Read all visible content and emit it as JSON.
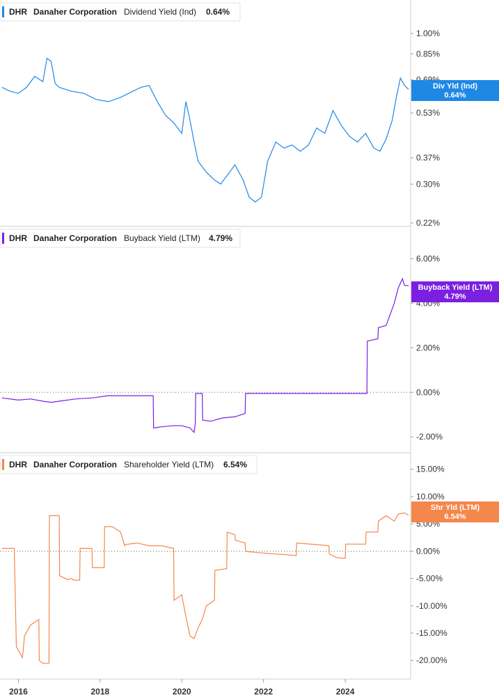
{
  "colors": {
    "dividend": "#1e88e5",
    "buyback": "#7b1fe0",
    "shareholder": "#f4874b",
    "grid_zero": "#666666",
    "axis": "#cccccc"
  },
  "chart_data": [
    {
      "type": "line",
      "panel": "dividend",
      "legend": {
        "ticker": "DHR",
        "company": "Danaher Corporation",
        "metric": "Dividend Yield (Ind)",
        "value": "0.64%"
      },
      "badge": {
        "label": "Div Yld (Ind)",
        "value": "0.64%"
      },
      "y_scale": "log",
      "ylim": [
        0.22,
        1.25
      ],
      "y_ticks": [
        1.0,
        0.85,
        0.69,
        0.53,
        0.37,
        0.3,
        0.22
      ],
      "y_tick_labels": [
        "1.00%",
        "0.85%",
        "0.69%",
        "0.53%",
        "0.37%",
        "0.30%",
        "0.22%"
      ],
      "zero_line": false,
      "series": [
        {
          "x": [
            2015.6,
            2015.8,
            2016.0,
            2016.2,
            2016.4,
            2016.6,
            2016.7,
            2016.8,
            2016.9,
            2017.0,
            2017.3,
            2017.6,
            2017.9,
            2018.2,
            2018.5,
            2018.8,
            2019.0,
            2019.2,
            2019.4,
            2019.6,
            2019.8,
            2020.0,
            2020.1,
            2020.2,
            2020.3,
            2020.4,
            2020.6,
            2020.8,
            2020.95,
            2021.1,
            2021.3,
            2021.5,
            2021.65,
            2021.8,
            2021.95,
            2022.1,
            2022.3,
            2022.5,
            2022.7,
            2022.9,
            2023.1,
            2023.3,
            2023.5,
            2023.7,
            2023.9,
            2024.1,
            2024.3,
            2024.5,
            2024.7,
            2024.85,
            2025.0,
            2025.15,
            2025.25,
            2025.35,
            2025.45,
            2025.55
          ],
          "y": [
            0.65,
            0.63,
            0.62,
            0.65,
            0.71,
            0.68,
            0.82,
            0.8,
            0.67,
            0.65,
            0.63,
            0.62,
            0.59,
            0.58,
            0.6,
            0.63,
            0.65,
            0.66,
            0.58,
            0.52,
            0.49,
            0.45,
            0.58,
            0.5,
            0.42,
            0.36,
            0.33,
            0.31,
            0.3,
            0.32,
            0.35,
            0.31,
            0.27,
            0.26,
            0.27,
            0.36,
            0.42,
            0.4,
            0.41,
            0.39,
            0.41,
            0.47,
            0.45,
            0.54,
            0.48,
            0.44,
            0.42,
            0.45,
            0.4,
            0.39,
            0.43,
            0.5,
            0.6,
            0.7,
            0.66,
            0.64
          ]
        }
      ]
    },
    {
      "type": "line",
      "panel": "buyback",
      "legend": {
        "ticker": "DHR",
        "company": "Danaher Corporation",
        "metric": "Buyback Yield (LTM)",
        "value": "4.79%"
      },
      "badge": {
        "label": "Buyback Yield (LTM)",
        "value": "4.79%"
      },
      "y_scale": "linear",
      "ylim": [
        -2.4,
        6.2
      ],
      "y_ticks": [
        6,
        4,
        2,
        0,
        -2
      ],
      "y_tick_labels": [
        "6.00%",
        "4.00%",
        "2.00%",
        "0.00%",
        "-2.00%"
      ],
      "zero_line": true,
      "series": [
        {
          "x": [
            2015.6,
            2016.0,
            2016.3,
            2016.6,
            2016.8,
            2017.0,
            2017.4,
            2017.8,
            2018.2,
            2018.6,
            2019.0,
            2019.3,
            2019.31,
            2019.5,
            2019.8,
            2020.0,
            2020.2,
            2020.3,
            2020.33,
            2020.34,
            2020.5,
            2020.51,
            2020.7,
            2021.0,
            2021.3,
            2021.55,
            2021.56,
            2022.0,
            2022.5,
            2023.0,
            2023.5,
            2024.0,
            2024.5,
            2024.53,
            2024.54,
            2024.8,
            2024.81,
            2025.0,
            2025.2,
            2025.3,
            2025.4,
            2025.45,
            2025.55
          ],
          "y": [
            -0.25,
            -0.35,
            -0.3,
            -0.4,
            -0.45,
            -0.4,
            -0.3,
            -0.25,
            -0.15,
            -0.15,
            -0.15,
            -0.15,
            -1.6,
            -1.55,
            -1.5,
            -1.5,
            -1.6,
            -1.8,
            -1.4,
            -0.05,
            -0.05,
            -1.25,
            -1.3,
            -1.15,
            -1.1,
            -0.95,
            -0.05,
            -0.05,
            -0.05,
            -0.05,
            -0.05,
            -0.05,
            -0.05,
            -0.05,
            2.3,
            2.4,
            2.9,
            3.0,
            4.0,
            4.7,
            5.1,
            4.8,
            4.79
          ]
        }
      ]
    },
    {
      "type": "line",
      "panel": "shareholder",
      "legend": {
        "ticker": "DHR",
        "company": "Danaher Corporation",
        "metric": "Shareholder Yield (LTM)",
        "value": "6.54%"
      },
      "badge": {
        "label": "Shr Yld (LTM)",
        "value": "6.54%"
      },
      "y_scale": "linear",
      "ylim": [
        -21.5,
        17
      ],
      "y_ticks": [
        15,
        10,
        5,
        0,
        -5,
        -10,
        -15,
        -20
      ],
      "y_tick_labels": [
        "15.00%",
        "10.00%",
        "5.00%",
        "0.00%",
        "-5.00%",
        "-10.00%",
        "-15.00%",
        "-20.00%"
      ],
      "zero_line": true,
      "series": [
        {
          "x": [
            2015.6,
            2015.9,
            2015.95,
            2016.1,
            2016.15,
            2016.3,
            2016.5,
            2016.51,
            2016.6,
            2016.75,
            2016.76,
            2017.0,
            2017.01,
            2017.2,
            2017.3,
            2017.35,
            2017.5,
            2017.51,
            2017.8,
            2017.81,
            2018.1,
            2018.11,
            2018.3,
            2018.5,
            2018.6,
            2018.61,
            2018.9,
            2019.2,
            2019.5,
            2019.8,
            2019.81,
            2020.0,
            2020.1,
            2020.2,
            2020.3,
            2020.4,
            2020.5,
            2020.6,
            2020.8,
            2020.81,
            2021.1,
            2021.11,
            2021.3,
            2021.31,
            2021.55,
            2021.56,
            2021.9,
            2022.3,
            2022.8,
            2022.81,
            2023.3,
            2023.6,
            2023.61,
            2023.8,
            2024.0,
            2024.01,
            2024.5,
            2024.51,
            2024.8,
            2024.81,
            2025.0,
            2025.2,
            2025.3,
            2025.45,
            2025.55
          ],
          "y": [
            0.5,
            0.5,
            -17.5,
            -19.5,
            -15.5,
            -13.5,
            -12.5,
            -20,
            -20.5,
            -20.5,
            6.5,
            6.5,
            -4.5,
            -5.2,
            -5.0,
            -5.3,
            -5.3,
            0.5,
            0.5,
            -3.0,
            -3.0,
            4.5,
            4.5,
            3.5,
            1.0,
            1.2,
            1.5,
            1.0,
            1.0,
            0.5,
            -9,
            -8,
            -12,
            -15.5,
            -16,
            -14,
            -12.5,
            -10,
            -9,
            -3.5,
            -3.2,
            3.5,
            3.0,
            2.0,
            1.5,
            0,
            -0.3,
            -0.5,
            -0.8,
            1.5,
            1.2,
            1.0,
            -0.5,
            -1.2,
            -1.3,
            1.3,
            1.3,
            3.5,
            3.5,
            5.5,
            6.5,
            5.5,
            6.8,
            7.0,
            6.54
          ]
        }
      ]
    }
  ],
  "x_axis": {
    "ticks": [
      2016,
      2018,
      2020,
      2022,
      2024
    ],
    "tick_labels": [
      "2016",
      "2018",
      "2020",
      "2022",
      "2024"
    ],
    "xlim": [
      2015.55,
      2025.6
    ]
  }
}
